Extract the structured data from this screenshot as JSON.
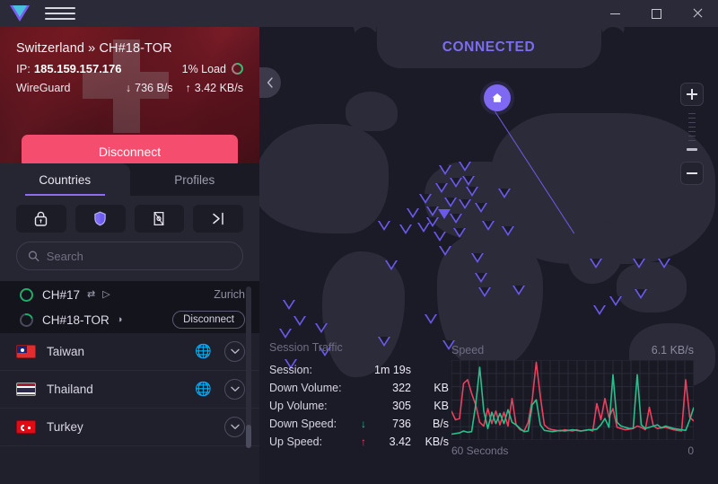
{
  "titlebar": {
    "logo_icon": "protonvpn-logo-icon",
    "menu_icon": "hamburger-menu-icon",
    "minimize_label": "",
    "maximize_label": "",
    "close_label": ""
  },
  "status_card": {
    "server_title": "Switzerland » CH#18-TOR",
    "ip_label": "IP:",
    "ip_value": "185.159.157.176",
    "load_text": "1% Load",
    "protocol": "WireGuard",
    "down_arrow": "↓",
    "down_speed": "736 B/s",
    "up_arrow": "↑",
    "up_speed": "3.42 KB/s",
    "disconnect_label": "Disconnect"
  },
  "tabs": [
    {
      "label": "Countries",
      "active": true
    },
    {
      "label": "Profiles",
      "active": false
    }
  ],
  "tool_buttons": [
    {
      "name": "secure-core-button",
      "icon": "lock-icon"
    },
    {
      "name": "netshield-button",
      "icon": "shield-icon"
    },
    {
      "name": "killswitch-button",
      "icon": "power-card-icon"
    },
    {
      "name": "portforward-button",
      "icon": "arrow-to-line-icon"
    }
  ],
  "search": {
    "placeholder": "Search",
    "value": "",
    "icon": "search-icon"
  },
  "servers": [
    {
      "name": "CH#17",
      "load_state": "full",
      "icons": [
        "swap-icon",
        "play-icon"
      ],
      "right_text": "Zurich",
      "right_type": "city"
    },
    {
      "name": "CH#18-TOR",
      "load_state": "partial",
      "icons": [
        "tor-onion-icon"
      ],
      "right_text": "Disconnect",
      "right_type": "button"
    }
  ],
  "countries": [
    {
      "name": "Taiwan",
      "flag": "tw",
      "has_globe": true,
      "chevron": "chevron-down-icon"
    },
    {
      "name": "Thailand",
      "flag": "th",
      "has_globe": true,
      "chevron": "chevron-down-icon"
    },
    {
      "name": "Turkey",
      "flag": "tr",
      "has_globe": false,
      "chevron": "chevron-down-icon"
    }
  ],
  "map": {
    "banner_text": "CONNECTED",
    "home_icon": "home-icon",
    "collapse_icon": "chevron-left-icon",
    "zoom_in_label": "+",
    "zoom_out_label": "−"
  },
  "session_traffic": {
    "title": "Session Traffic",
    "rows": [
      {
        "label": "Session:",
        "arrow": "",
        "value": "1m 19s",
        "unit": ""
      },
      {
        "label": "Down Volume:",
        "arrow": "",
        "value": "322",
        "unit": "KB"
      },
      {
        "label": "Up Volume:",
        "arrow": "",
        "value": "305",
        "unit": "KB"
      },
      {
        "label": "Down Speed:",
        "arrow": "↓",
        "value": "736",
        "unit": "B/s"
      },
      {
        "label": "Up Speed:",
        "arrow": "↑",
        "value": "3.42",
        "unit": "KB/s"
      }
    ]
  },
  "colors": {
    "accent_purple": "#7c6df0",
    "disconnect_red": "#f54d6e",
    "download_green": "#27c08a",
    "upload_red": "#e8415f",
    "sidebar_bg": "#20202c",
    "map_bg": "#1b1b27"
  },
  "chart_data": {
    "type": "line",
    "title": "Speed",
    "xlabel": "",
    "ylabel": "",
    "x_tick_labels": [
      "60 Seconds",
      "0"
    ],
    "max_label": "6.1  KB/s",
    "ylim": [
      0,
      6.1
    ],
    "grid": true,
    "legend": "none",
    "x": [
      0,
      1,
      2,
      3,
      4,
      5,
      6,
      7,
      8,
      9,
      10,
      11,
      12,
      13,
      14,
      15,
      16,
      17,
      18,
      19,
      20,
      21,
      22,
      23,
      24,
      25,
      26,
      27,
      28,
      29,
      30,
      31,
      32,
      33,
      34,
      35,
      36,
      37,
      38,
      39,
      40,
      41,
      42,
      43,
      44,
      45,
      46,
      47,
      48,
      49,
      50,
      51,
      52,
      53,
      54,
      55,
      56,
      57,
      58,
      59,
      60
    ],
    "series": [
      {
        "name": "Upload",
        "color": "#e8415f",
        "values": [
          2.1,
          1.4,
          1.5,
          4.3,
          4.6,
          3.5,
          2.6,
          1.2,
          0.9,
          2.3,
          1.1,
          2.1,
          1.0,
          2.0,
          0.9,
          3.1,
          1.0,
          0.6,
          0.5,
          1.2,
          3.0,
          6.0,
          3.3,
          1.0,
          0.7,
          0.6,
          0.55,
          0.5,
          0.6,
          0.55,
          0.5,
          0.6,
          0.5,
          0.55,
          0.6,
          0.5,
          2.7,
          1.4,
          3.1,
          1.6,
          2.3,
          0.8,
          0.7,
          0.6,
          0.65,
          0.7,
          0.9,
          0.8,
          0.6,
          2.4,
          0.9,
          0.7,
          0.75,
          0.8,
          0.7,
          0.6,
          0.55,
          0.5,
          4.6,
          1.6,
          1.3
        ]
      },
      {
        "name": "Download",
        "color": "#27c08a",
        "values": [
          0.25,
          0.3,
          0.35,
          0.5,
          0.4,
          0.45,
          2.6,
          5.6,
          2.1,
          0.7,
          2.0,
          1.1,
          1.9,
          1.1,
          2.2,
          1.2,
          1.0,
          0.7,
          0.45,
          0.5,
          2.6,
          3.0,
          1.0,
          0.55,
          0.5,
          0.45,
          0.5,
          0.55,
          0.5,
          0.55,
          0.6,
          0.55,
          0.5,
          0.55,
          0.6,
          0.6,
          0.65,
          1.0,
          1.5,
          0.8,
          5.0,
          1.2,
          0.9,
          0.8,
          0.7,
          0.7,
          5.0,
          1.0,
          0.7,
          0.8,
          0.9,
          1.0,
          0.75,
          0.9,
          0.8,
          0.7,
          0.65,
          0.6,
          0.55,
          1.4,
          2.4
        ]
      }
    ]
  }
}
